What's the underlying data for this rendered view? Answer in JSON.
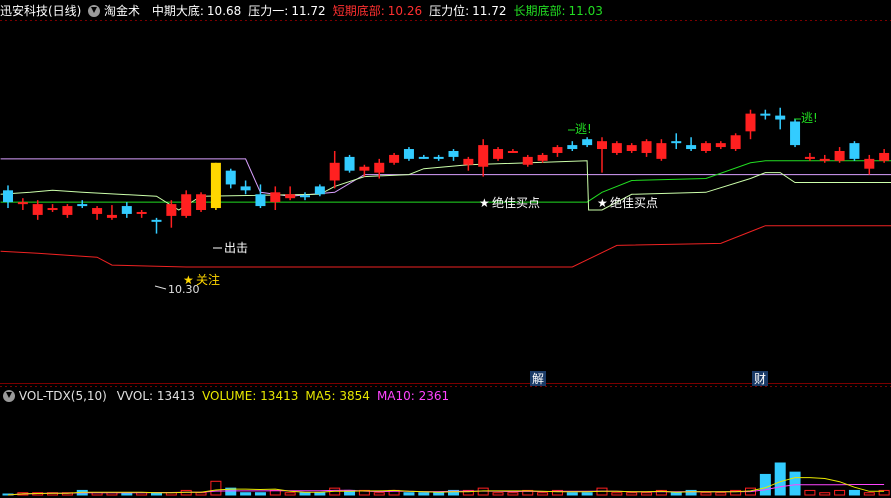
{
  "header": {
    "stock_name": "迅安科技(日线)",
    "indicator_name": "淘金术",
    "items": [
      {
        "label": "中期大底:",
        "value": "10.68",
        "label_color": "#ffffff",
        "value_color": "#ffffff"
      },
      {
        "label": "压力一:",
        "value": "11.72",
        "label_color": "#ffffff",
        "value_color": "#ffffff"
      },
      {
        "label": "短期底部:",
        "value": "10.26",
        "label_color": "#ff3030",
        "value_color": "#ff3030"
      },
      {
        "label": "压力位:",
        "value": "11.72",
        "label_color": "#ffffff",
        "value_color": "#ffffff"
      },
      {
        "label": "长期底部:",
        "value": "11.03",
        "label_color": "#22dd22",
        "value_color": "#22dd22"
      }
    ]
  },
  "volume_header": {
    "name": "VOL-TDX(5,10)",
    "items": [
      {
        "text": "VVOL: 13413",
        "color": "#e0e0e0"
      },
      {
        "text": "VOLUME: 13413",
        "color": "#e8e800"
      },
      {
        "text": "MA5: 3854",
        "color": "#e8e800"
      },
      {
        "text": "MA10: 2361",
        "color": "#ff44ff"
      }
    ]
  },
  "annotations": {
    "chuji": "出击",
    "guanzhu": "关注",
    "low_price": "10.30",
    "buy_point_1": "绝佳买点",
    "buy_point_2": "绝佳买点",
    "escape_1": "逃!",
    "escape_2": "逃!",
    "marker_jie": "解",
    "marker_cai": "财"
  },
  "colors": {
    "up": "#ff2020",
    "down": "#33ccff",
    "signal": "#ffd700",
    "resistance": "#d9a0ff",
    "green_line": "#22dd22",
    "support": "#ccffaa",
    "red_line": "#ee2222",
    "ma10": "#ff44ff",
    "ma5": "#e8e800"
  },
  "chart_data": {
    "type": "candlestick",
    "y_range_price": [
      9.6,
      12.0
    ],
    "candles": [
      {
        "i": 0,
        "o": 11.0,
        "h": 11.05,
        "l": 10.82,
        "c": 10.88,
        "kind": "down"
      },
      {
        "i": 1,
        "o": 10.88,
        "h": 10.92,
        "l": 10.8,
        "c": 10.86,
        "kind": "up"
      },
      {
        "i": 2,
        "o": 10.86,
        "h": 10.9,
        "l": 10.7,
        "c": 10.75,
        "kind": "up"
      },
      {
        "i": 3,
        "o": 10.8,
        "h": 10.86,
        "l": 10.78,
        "c": 10.82,
        "kind": "up"
      },
      {
        "i": 4,
        "o": 10.75,
        "h": 10.86,
        "l": 10.72,
        "c": 10.84,
        "kind": "up"
      },
      {
        "i": 5,
        "o": 10.84,
        "h": 10.9,
        "l": 10.82,
        "c": 10.86,
        "kind": "down"
      },
      {
        "i": 6,
        "o": 10.82,
        "h": 10.84,
        "l": 10.7,
        "c": 10.76,
        "kind": "up"
      },
      {
        "i": 7,
        "o": 10.75,
        "h": 10.85,
        "l": 10.7,
        "c": 10.72,
        "kind": "up"
      },
      {
        "i": 8,
        "o": 10.84,
        "h": 10.88,
        "l": 10.72,
        "c": 10.76,
        "kind": "down"
      },
      {
        "i": 9,
        "o": 10.76,
        "h": 10.8,
        "l": 10.72,
        "c": 10.78,
        "kind": "up"
      },
      {
        "i": 10,
        "o": 10.7,
        "h": 10.72,
        "l": 10.56,
        "c": 10.68,
        "kind": "down"
      },
      {
        "i": 11,
        "o": 10.74,
        "h": 10.9,
        "l": 10.62,
        "c": 10.86,
        "kind": "up"
      },
      {
        "i": 12,
        "o": 10.74,
        "h": 11.0,
        "l": 10.72,
        "c": 10.96,
        "kind": "up"
      },
      {
        "i": 13,
        "o": 10.8,
        "h": 10.98,
        "l": 10.78,
        "c": 10.96,
        "kind": "up"
      },
      {
        "i": 14,
        "o": 10.82,
        "h": 11.28,
        "l": 10.8,
        "c": 11.28,
        "kind": "signal"
      },
      {
        "i": 15,
        "o": 11.2,
        "h": 11.22,
        "l": 11.02,
        "c": 11.06,
        "kind": "down"
      },
      {
        "i": 16,
        "o": 11.04,
        "h": 11.1,
        "l": 10.96,
        "c": 11.0,
        "kind": "down"
      },
      {
        "i": 17,
        "o": 10.96,
        "h": 11.06,
        "l": 10.82,
        "c": 10.84,
        "kind": "down"
      },
      {
        "i": 18,
        "o": 10.88,
        "h": 11.04,
        "l": 10.8,
        "c": 10.98,
        "kind": "up"
      },
      {
        "i": 19,
        "o": 10.96,
        "h": 11.04,
        "l": 10.9,
        "c": 10.92,
        "kind": "up"
      },
      {
        "i": 20,
        "o": 10.94,
        "h": 10.98,
        "l": 10.9,
        "c": 10.95,
        "kind": "down"
      },
      {
        "i": 21,
        "o": 11.04,
        "h": 11.06,
        "l": 10.94,
        "c": 10.96,
        "kind": "down"
      },
      {
        "i": 22,
        "o": 11.1,
        "h": 11.4,
        "l": 11.02,
        "c": 11.28,
        "kind": "up"
      },
      {
        "i": 23,
        "o": 11.34,
        "h": 11.36,
        "l": 11.18,
        "c": 11.2,
        "kind": "down"
      },
      {
        "i": 24,
        "o": 11.2,
        "h": 11.26,
        "l": 11.14,
        "c": 11.24,
        "kind": "up"
      },
      {
        "i": 25,
        "o": 11.18,
        "h": 11.32,
        "l": 11.12,
        "c": 11.28,
        "kind": "up"
      },
      {
        "i": 26,
        "o": 11.28,
        "h": 11.38,
        "l": 11.26,
        "c": 11.36,
        "kind": "up"
      },
      {
        "i": 27,
        "o": 11.42,
        "h": 11.44,
        "l": 11.3,
        "c": 11.32,
        "kind": "down"
      },
      {
        "i": 28,
        "o": 11.34,
        "h": 11.36,
        "l": 11.32,
        "c": 11.34,
        "kind": "down"
      },
      {
        "i": 29,
        "o": 11.34,
        "h": 11.36,
        "l": 11.3,
        "c": 11.32,
        "kind": "down"
      },
      {
        "i": 30,
        "o": 11.4,
        "h": 11.42,
        "l": 11.3,
        "c": 11.34,
        "kind": "down"
      },
      {
        "i": 31,
        "o": 11.32,
        "h": 11.34,
        "l": 11.2,
        "c": 11.26,
        "kind": "up"
      },
      {
        "i": 32,
        "o": 11.24,
        "h": 11.52,
        "l": 11.14,
        "c": 11.46,
        "kind": "up"
      },
      {
        "i": 33,
        "o": 11.32,
        "h": 11.44,
        "l": 11.3,
        "c": 11.42,
        "kind": "up"
      },
      {
        "i": 34,
        "o": 11.4,
        "h": 11.42,
        "l": 11.38,
        "c": 11.4,
        "kind": "up"
      },
      {
        "i": 35,
        "o": 11.26,
        "h": 11.36,
        "l": 11.24,
        "c": 11.34,
        "kind": "up"
      },
      {
        "i": 36,
        "o": 11.3,
        "h": 11.38,
        "l": 11.28,
        "c": 11.36,
        "kind": "up"
      },
      {
        "i": 37,
        "o": 11.38,
        "h": 11.46,
        "l": 11.34,
        "c": 11.44,
        "kind": "up"
      },
      {
        "i": 38,
        "o": 11.46,
        "h": 11.5,
        "l": 11.4,
        "c": 11.42,
        "kind": "down"
      },
      {
        "i": 39,
        "o": 11.52,
        "h": 11.54,
        "l": 11.44,
        "c": 11.46,
        "kind": "down"
      },
      {
        "i": 40,
        "o": 11.42,
        "h": 11.54,
        "l": 11.18,
        "c": 11.5,
        "kind": "up"
      },
      {
        "i": 41,
        "o": 11.38,
        "h": 11.5,
        "l": 11.36,
        "c": 11.48,
        "kind": "up"
      },
      {
        "i": 42,
        "o": 11.4,
        "h": 11.48,
        "l": 11.38,
        "c": 11.46,
        "kind": "up"
      },
      {
        "i": 43,
        "o": 11.38,
        "h": 11.52,
        "l": 11.34,
        "c": 11.5,
        "kind": "up"
      },
      {
        "i": 44,
        "o": 11.32,
        "h": 11.52,
        "l": 11.3,
        "c": 11.48,
        "kind": "up"
      },
      {
        "i": 45,
        "o": 11.5,
        "h": 11.58,
        "l": 11.42,
        "c": 11.48,
        "kind": "down"
      },
      {
        "i": 46,
        "o": 11.46,
        "h": 11.54,
        "l": 11.4,
        "c": 11.42,
        "kind": "down"
      },
      {
        "i": 47,
        "o": 11.4,
        "h": 11.5,
        "l": 11.38,
        "c": 11.48,
        "kind": "up"
      },
      {
        "i": 48,
        "o": 11.44,
        "h": 11.5,
        "l": 11.42,
        "c": 11.48,
        "kind": "up"
      },
      {
        "i": 49,
        "o": 11.42,
        "h": 11.58,
        "l": 11.4,
        "c": 11.56,
        "kind": "up"
      },
      {
        "i": 50,
        "o": 11.6,
        "h": 11.82,
        "l": 11.52,
        "c": 11.78,
        "kind": "up"
      },
      {
        "i": 51,
        "o": 11.78,
        "h": 11.82,
        "l": 11.72,
        "c": 11.76,
        "kind": "down"
      },
      {
        "i": 52,
        "o": 11.76,
        "h": 11.84,
        "l": 11.62,
        "c": 11.72,
        "kind": "down"
      },
      {
        "i": 53,
        "o": 11.7,
        "h": 11.72,
        "l": 11.44,
        "c": 11.46,
        "kind": "down"
      },
      {
        "i": 54,
        "o": 11.34,
        "h": 11.38,
        "l": 11.3,
        "c": 11.33,
        "kind": "up"
      },
      {
        "i": 55,
        "o": 11.32,
        "h": 11.36,
        "l": 11.28,
        "c": 11.3,
        "kind": "up"
      },
      {
        "i": 56,
        "o": 11.3,
        "h": 11.44,
        "l": 11.28,
        "c": 11.4,
        "kind": "up"
      },
      {
        "i": 57,
        "o": 11.48,
        "h": 11.5,
        "l": 11.3,
        "c": 11.32,
        "kind": "down"
      },
      {
        "i": 58,
        "o": 11.32,
        "h": 11.36,
        "l": 11.16,
        "c": 11.22,
        "kind": "up"
      },
      {
        "i": 59,
        "o": 11.3,
        "h": 11.42,
        "l": 11.28,
        "c": 11.38,
        "kind": "up"
      }
    ],
    "volume_range": [
      0,
      13413
    ]
  }
}
